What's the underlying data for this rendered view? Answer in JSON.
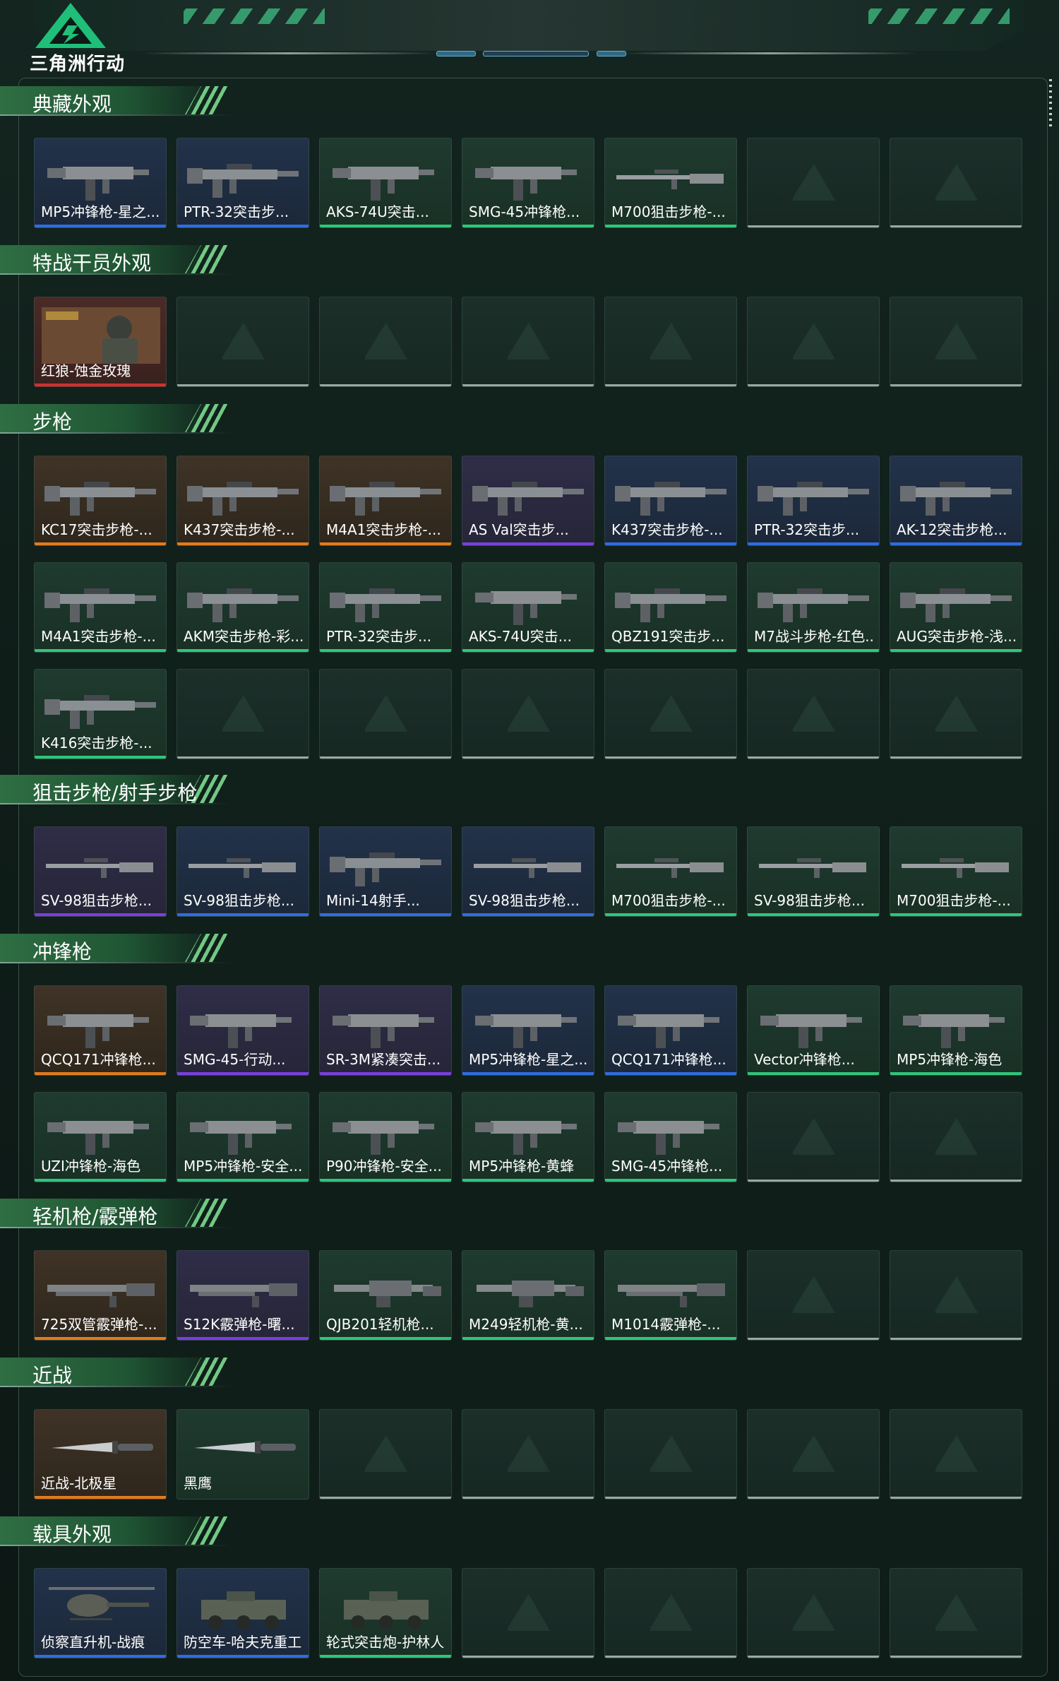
{
  "app": {
    "logo_text": "三角洲行动"
  },
  "colors": {
    "purple": "#7a3fe0",
    "gold": "#e37b1c",
    "blue": "#2f6de0",
    "green": "#2fc67a",
    "red": "#d32f2f"
  },
  "sections": [
    {
      "title": "典藏外观",
      "items": [
        {
          "label": "MP5冲锋枪-星之...",
          "rarity": "blue",
          "icon": "smg-icon"
        },
        {
          "label": "PTR-32突击步...",
          "rarity": "blue",
          "icon": "rifle-icon"
        },
        {
          "label": "AKS-74U突击...",
          "rarity": "green",
          "icon": "smg-icon"
        },
        {
          "label": "SMG-45冲锋枪...",
          "rarity": "green",
          "icon": "smg-icon"
        },
        {
          "label": "M700狙击步枪-...",
          "rarity": "green",
          "icon": "sniper-icon"
        },
        null,
        null
      ]
    },
    {
      "title": "特战干员外观",
      "items": [
        {
          "label": "红狼-蚀金玫瑰",
          "rarity": "red",
          "icon": "operator-portrait-icon"
        },
        null,
        null,
        null,
        null,
        null,
        null
      ]
    },
    {
      "title": "步枪",
      "items": [
        {
          "label": "KC17突击步枪-...",
          "rarity": "gold",
          "icon": "rifle-icon"
        },
        {
          "label": "K437突击步枪-...",
          "rarity": "gold",
          "icon": "rifle-icon"
        },
        {
          "label": "M4A1突击步枪-...",
          "rarity": "gold",
          "icon": "rifle-icon"
        },
        {
          "label": "AS Val突击步...",
          "rarity": "purple",
          "icon": "rifle-icon"
        },
        {
          "label": "K437突击步枪-...",
          "rarity": "blue",
          "icon": "rifle-icon"
        },
        {
          "label": "PTR-32突击步...",
          "rarity": "blue",
          "icon": "rifle-icon"
        },
        {
          "label": "AK-12突击步枪...",
          "rarity": "blue",
          "icon": "rifle-icon"
        },
        {
          "label": "M4A1突击步枪-...",
          "rarity": "green",
          "icon": "rifle-icon"
        },
        {
          "label": "AKM突击步枪-彩...",
          "rarity": "green",
          "icon": "rifle-icon"
        },
        {
          "label": "PTR-32突击步...",
          "rarity": "green",
          "icon": "rifle-icon"
        },
        {
          "label": "AKS-74U突击...",
          "rarity": "green",
          "icon": "smg-icon"
        },
        {
          "label": "QBZ191突击步...",
          "rarity": "green",
          "icon": "rifle-icon"
        },
        {
          "label": "M7战斗步枪-红色...",
          "rarity": "green",
          "icon": "rifle-icon"
        },
        {
          "label": "AUG突击步枪-浅...",
          "rarity": "green",
          "icon": "rifle-icon"
        },
        {
          "label": "K416突击步枪-...",
          "rarity": "green",
          "icon": "rifle-icon"
        },
        null,
        null,
        null,
        null,
        null,
        null
      ]
    },
    {
      "title": "狙击步枪/射手步枪",
      "items": [
        {
          "label": "SV-98狙击步枪...",
          "rarity": "purple",
          "icon": "sniper-icon"
        },
        {
          "label": "SV-98狙击步枪...",
          "rarity": "blue",
          "icon": "sniper-icon"
        },
        {
          "label": "Mini-14射手...",
          "rarity": "blue",
          "icon": "rifle-icon"
        },
        {
          "label": "SV-98狙击步枪...",
          "rarity": "blue",
          "icon": "sniper-icon"
        },
        {
          "label": "M700狙击步枪-...",
          "rarity": "green",
          "icon": "sniper-icon"
        },
        {
          "label": "SV-98狙击步枪...",
          "rarity": "green",
          "icon": "sniper-icon"
        },
        {
          "label": "M700狙击步枪-...",
          "rarity": "green",
          "icon": "sniper-icon"
        }
      ]
    },
    {
      "title": "冲锋枪",
      "items": [
        {
          "label": "QCQ171冲锋枪...",
          "rarity": "gold",
          "icon": "smg-icon"
        },
        {
          "label": "SMG-45-行动...",
          "rarity": "purple",
          "icon": "smg-icon"
        },
        {
          "label": "SR-3M紧凑突击...",
          "rarity": "purple",
          "icon": "smg-icon"
        },
        {
          "label": "MP5冲锋枪-星之...",
          "rarity": "blue",
          "icon": "smg-icon"
        },
        {
          "label": "QCQ171冲锋枪...",
          "rarity": "blue",
          "icon": "smg-icon"
        },
        {
          "label": "Vector冲锋枪...",
          "rarity": "green",
          "icon": "smg-icon"
        },
        {
          "label": "MP5冲锋枪-海色",
          "rarity": "green",
          "icon": "smg-icon"
        },
        {
          "label": "UZI冲锋枪-海色",
          "rarity": "green",
          "icon": "smg-icon"
        },
        {
          "label": "MP5冲锋枪-安全...",
          "rarity": "green",
          "icon": "smg-icon"
        },
        {
          "label": "P90冲锋枪-安全...",
          "rarity": "green",
          "icon": "smg-icon"
        },
        {
          "label": "MP5冲锋枪-黄蜂",
          "rarity": "green",
          "icon": "smg-icon"
        },
        {
          "label": "SMG-45冲锋枪...",
          "rarity": "green",
          "icon": "smg-icon"
        },
        null,
        null
      ]
    },
    {
      "title": "轻机枪/霰弹枪",
      "items": [
        {
          "label": "725双管霰弹枪-...",
          "rarity": "gold",
          "icon": "shotgun-icon"
        },
        {
          "label": "S12K霰弹枪-曙...",
          "rarity": "purple",
          "icon": "shotgun-icon"
        },
        {
          "label": "QJB201轻机枪...",
          "rarity": "green",
          "icon": "lmg-icon"
        },
        {
          "label": "M249轻机枪-黄...",
          "rarity": "green",
          "icon": "lmg-icon"
        },
        {
          "label": "M1014霰弹枪-...",
          "rarity": "green",
          "icon": "shotgun-icon"
        },
        null,
        null
      ]
    },
    {
      "title": "近战",
      "items": [
        {
          "label": "近战-北极星",
          "rarity": "gold",
          "icon": "knife-icon"
        },
        {
          "label": "黑鹰",
          "rarity": "none",
          "icon": "knife-icon"
        },
        null,
        null,
        null,
        null,
        null
      ]
    },
    {
      "title": "载具外观",
      "items": [
        {
          "label": "侦察直升机-战痕",
          "rarity": "blue",
          "icon": "helicopter-icon"
        },
        {
          "label": "防空车-哈夫克重工",
          "rarity": "blue",
          "icon": "armored-vehicle-icon"
        },
        {
          "label": "轮式突击炮-护林人",
          "rarity": "green",
          "icon": "armored-vehicle-icon"
        },
        null,
        null,
        null,
        null
      ]
    }
  ]
}
